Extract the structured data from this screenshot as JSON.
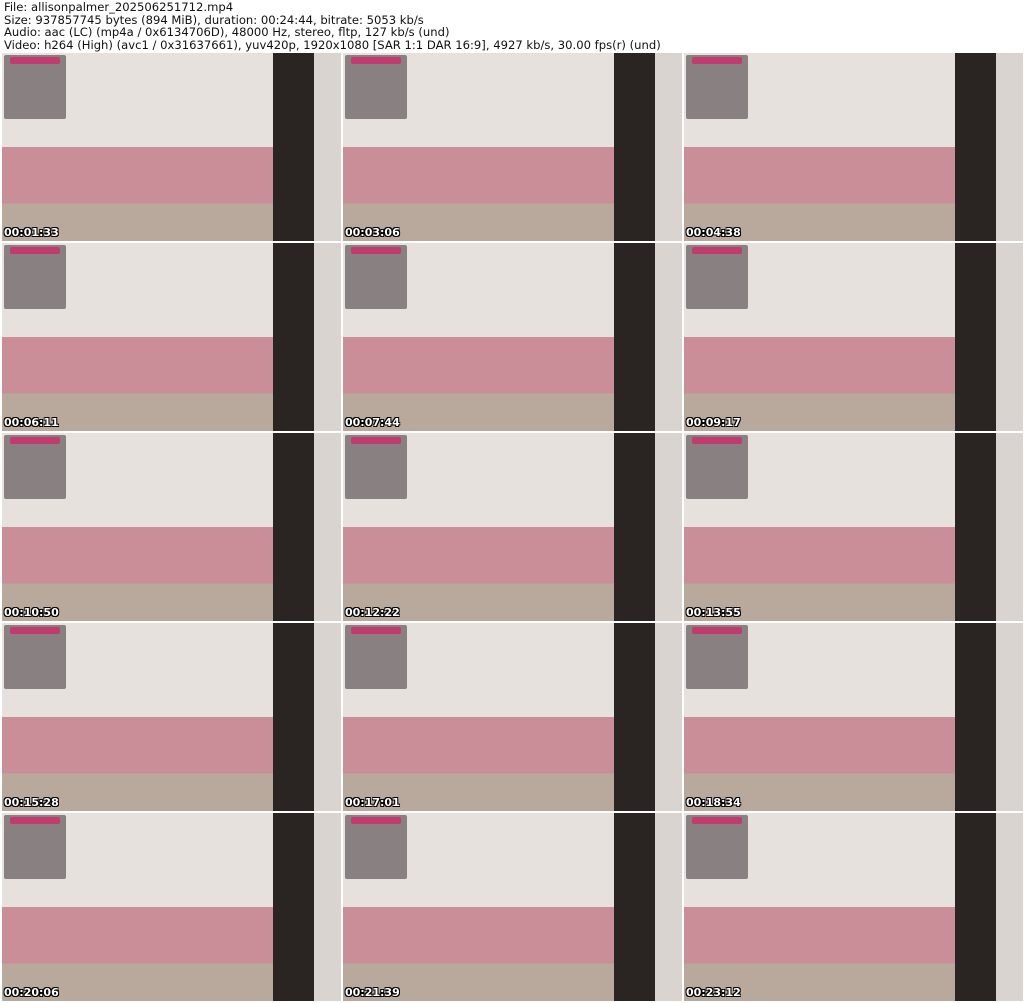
{
  "header": {
    "file": "File: allisonpalmer_202506251712.mp4",
    "size": "Size: 937857745 bytes (894 MiB), duration: 00:24:44, bitrate: 5053 kb/s",
    "audio": "Audio: aac (LC) (mp4a / 0x6134706D), 48000 Hz, stereo, fltp, 127 kb/s (und)",
    "video": "Video: h264 (High) (avc1 / 0x31637661), yuv420p, 1920x1080 [SAR 1:1 DAR 16:9], 4927 kb/s, 30.00 fps(r) (und)"
  },
  "thumbnails": [
    "00:01:33",
    "00:03:06",
    "00:04:38",
    "00:06:11",
    "00:07:44",
    "00:09:17",
    "00:10:50",
    "00:12:22",
    "00:13:55",
    "00:15:28",
    "00:17:01",
    "00:18:34",
    "00:20:06",
    "00:21:39",
    "00:23:12"
  ]
}
